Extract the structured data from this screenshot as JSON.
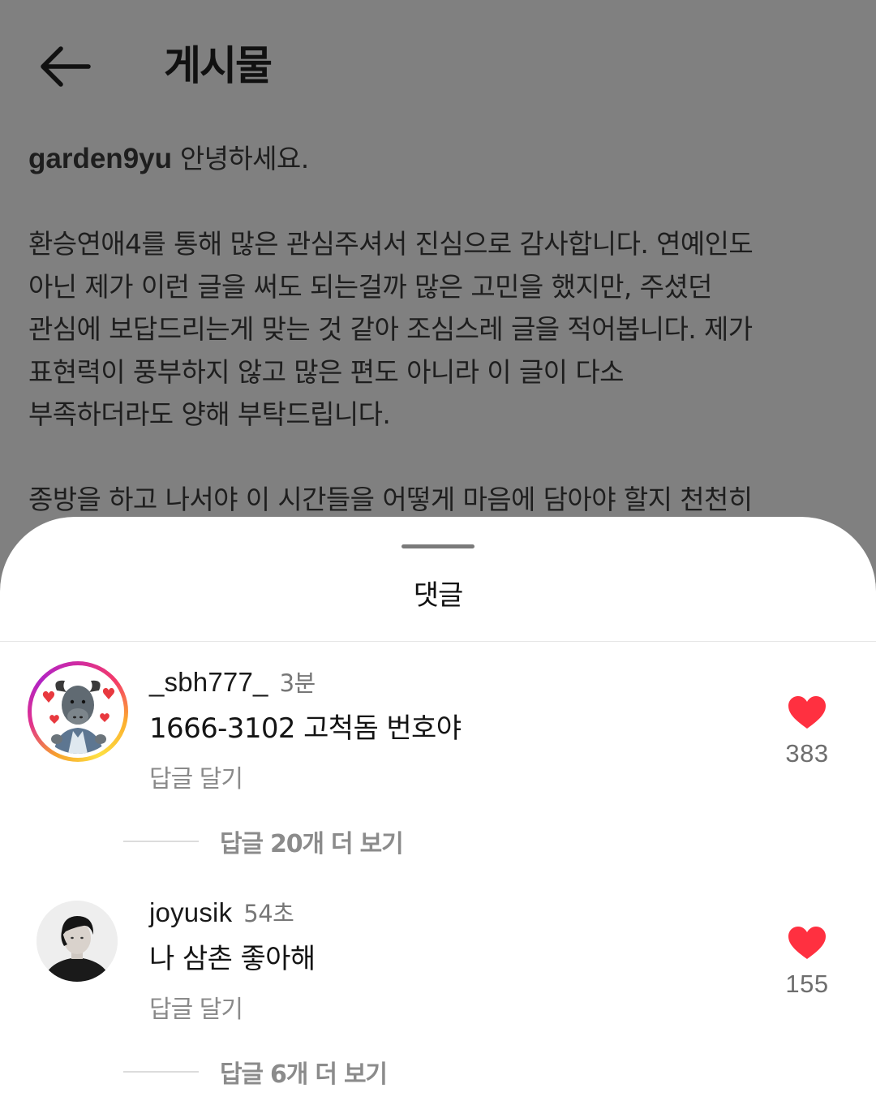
{
  "header": {
    "title": "게시물",
    "back_icon": "arrow-left-icon"
  },
  "post": {
    "author": "garden9yu",
    "lines": [
      "안녕하세요.",
      "",
      "환승연애4를 통해 많은 관심주셔서 진심으로 감사합니다. 연예인도",
      "아닌 제가 이런 글을 써도 되는걸까 많은 고민을 했지만, 주셨던",
      "관심에 보답드리는게 맞는 것 같아 조심스레 글을 적어봅니다. 제가",
      "표현력이 풍부하지 않고 많은 편도 아니라 이 글이 다소",
      "부족하더라도 양해 부탁드립니다.",
      "",
      "종방을 하고 나서야 이 시간들을 어떻게 마음에 담아야 할지 천천히"
    ]
  },
  "comments_sheet": {
    "title": "댓글",
    "comments": [
      {
        "username": "_sbh777_",
        "time": "3분",
        "text": "1666-3102 고척돔 번호야",
        "reply_label": "답글 달기",
        "like_count": "383",
        "liked": true,
        "more_replies": "답글 20개 더 보기",
        "avatar_story_ring": true
      },
      {
        "username": "joyusik",
        "time": "54초",
        "text": "나 삼촌 좋아해",
        "reply_label": "답글 달기",
        "like_count": "155",
        "liked": true,
        "more_replies": "답글 6개 더 보기",
        "avatar_story_ring": false
      }
    ]
  },
  "colors": {
    "dim_overlay": "#808080",
    "sheet_bg": "#ffffff",
    "like_red": "#ff3040",
    "muted_text": "#8a8a8a"
  }
}
